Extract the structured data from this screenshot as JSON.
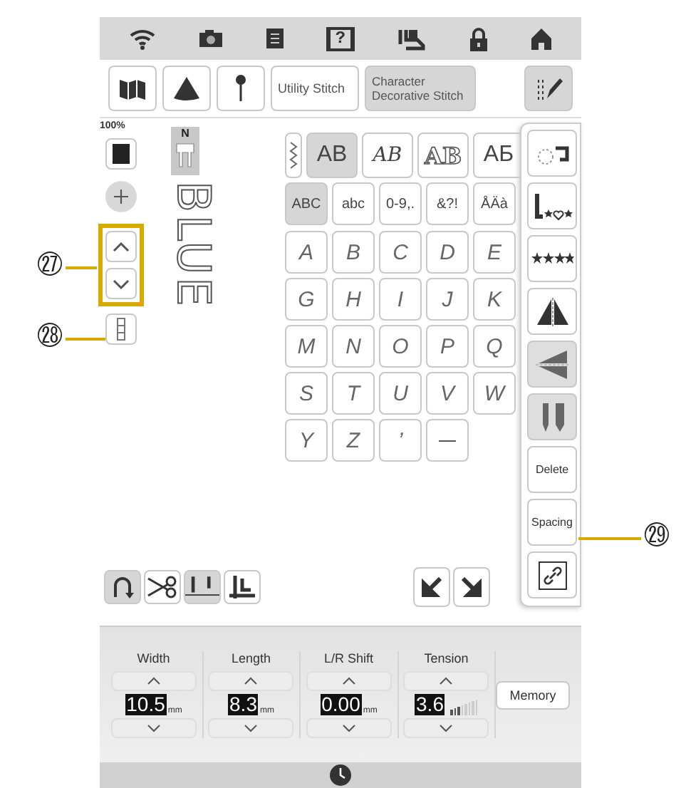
{
  "top_bar": {
    "help_glyph": "?"
  },
  "mode_row": {
    "tabs": [
      {
        "label": "Utility Stitch",
        "selected": false
      },
      {
        "label": "Character Decorative Stitch",
        "selected": true
      }
    ]
  },
  "left_panel": {
    "zoom": "100%",
    "foot_letter": "N",
    "preview_text": "BLUE"
  },
  "font_tabs": [
    {
      "kind": "wave",
      "selected": false
    },
    {
      "kind": "plain",
      "label": "AB",
      "selected": true
    },
    {
      "kind": "script",
      "label": "AB",
      "selected": false
    },
    {
      "kind": "outline",
      "label": "AB",
      "selected": false
    },
    {
      "kind": "plain",
      "label": "АБ",
      "selected": false
    }
  ],
  "char_sets": [
    {
      "label": "ABC",
      "selected": true
    },
    {
      "label": "abc",
      "selected": false
    },
    {
      "label": "0-9,.",
      "selected": false
    },
    {
      "label": "&?!",
      "selected": false
    },
    {
      "label": "ÅÄà",
      "selected": false
    }
  ],
  "keys": [
    {
      "kind": "char",
      "label": "A"
    },
    {
      "kind": "char",
      "label": "B"
    },
    {
      "kind": "char",
      "label": "C"
    },
    {
      "kind": "char",
      "label": "D"
    },
    {
      "kind": "char",
      "label": "E"
    },
    {
      "kind": "char",
      "label": "G"
    },
    {
      "kind": "char",
      "label": "H"
    },
    {
      "kind": "char",
      "label": "I"
    },
    {
      "kind": "char",
      "label": "J"
    },
    {
      "kind": "char",
      "label": "K"
    },
    {
      "kind": "char",
      "label": "M"
    },
    {
      "kind": "char",
      "label": "N"
    },
    {
      "kind": "char",
      "label": "O"
    },
    {
      "kind": "char",
      "label": "P"
    },
    {
      "kind": "char",
      "label": "Q"
    },
    {
      "kind": "char",
      "label": "S"
    },
    {
      "kind": "char",
      "label": "T"
    },
    {
      "kind": "char",
      "label": "U"
    },
    {
      "kind": "char",
      "label": "V"
    },
    {
      "kind": "char",
      "label": "W"
    },
    {
      "kind": "char",
      "label": "Y"
    },
    {
      "kind": "char",
      "label": "Z"
    },
    {
      "kind": "char",
      "label": "’"
    },
    {
      "kind": "space"
    }
  ],
  "side_tools": [
    {
      "kind": "icon",
      "disabled": false
    },
    {
      "kind": "icon",
      "disabled": false
    },
    {
      "kind": "icon",
      "disabled": false
    },
    {
      "kind": "icon",
      "disabled": false
    },
    {
      "kind": "icon",
      "disabled": true
    },
    {
      "kind": "icon",
      "disabled": true
    },
    {
      "kind": "text",
      "label": "Delete",
      "disabled": false
    },
    {
      "kind": "text",
      "label": "Spacing",
      "disabled": false
    },
    {
      "kind": "icon",
      "disabled": false
    }
  ],
  "bottom_tools": [
    {
      "on": true
    },
    {
      "on": false
    },
    {
      "on": true
    },
    {
      "on": false
    }
  ],
  "params": [
    {
      "label": "Width",
      "value": "10.5",
      "unit": "mm"
    },
    {
      "label": "Length",
      "value": "8.3",
      "unit": "mm"
    },
    {
      "label": "L/R Shift",
      "value": "0.00",
      "unit": "mm"
    },
    {
      "label": "Tension",
      "value": "3.6",
      "level": 0.4
    }
  ],
  "memory_button": "Memory",
  "callouts": [
    {
      "number": "㉗"
    },
    {
      "number": "㉘"
    },
    {
      "number": "㉙"
    }
  ]
}
